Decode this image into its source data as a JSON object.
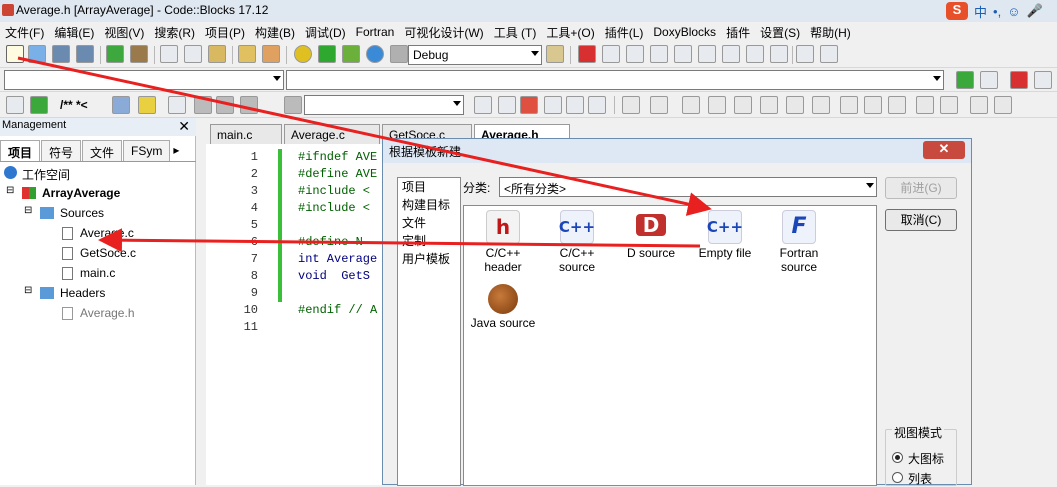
{
  "window": {
    "title": "Average.h [ArrayAverage] - Code::Blocks 17.12"
  },
  "ime": {
    "logo": "S",
    "lang": "中",
    "punct": "•,",
    "emoji": "☺",
    "mic": "🎤"
  },
  "menubar": [
    "文件(F)",
    "编辑(E)",
    "视图(V)",
    "搜索(R)",
    "项目(P)",
    "构建(B)",
    "调试(D)",
    "Fortran",
    "可视化设计(W)",
    "工具 (T)",
    "工具+(O)",
    "插件(L)",
    "DoxyBlocks",
    "插件",
    "设置(S)",
    "帮助(H)"
  ],
  "toolbar": {
    "build_target": "Debug",
    "comment_btn": "/** *<"
  },
  "management": {
    "title": "Management",
    "tabs": [
      "项目",
      "符号",
      "文件",
      "FSym"
    ],
    "workspace": "工作空间",
    "project": "ArrayAverage",
    "sources_folder": "Sources",
    "sources": [
      "Average.c",
      "GetSoce.c",
      "main.c"
    ],
    "headers_folder": "Headers",
    "headers": [
      "Average.h"
    ]
  },
  "editor": {
    "tabs": [
      "main.c",
      "Average.c",
      "GetSoce.c",
      "Average.h"
    ],
    "active_tab": "Average.h",
    "line_numbers": [
      "1",
      "2",
      "3",
      "4",
      "5",
      "6",
      "7",
      "8",
      "9",
      "10",
      "11"
    ],
    "lines": [
      "#ifndef AVE",
      "#define AVE",
      "#include <",
      "#include <",
      "",
      "#define N",
      "int Average",
      "void  GetS",
      "",
      "#endif // A",
      ""
    ]
  },
  "dialog": {
    "title": "根据模板新建",
    "categories": [
      "项目",
      "构建目标",
      "文件",
      "定制",
      "用户模板"
    ],
    "category_label": "分类:",
    "category_value": "<所有分类>",
    "next_button": "前进(G)",
    "cancel_button": "取消(C)",
    "templates": [
      {
        "label": "C/C++ header",
        "icon": "h",
        "color": "#c01818"
      },
      {
        "label": "C/C++ source",
        "icon": "C++",
        "color": "#1b46b8"
      },
      {
        "label": "D source",
        "icon": "D",
        "color": "#c0302c"
      },
      {
        "label": "Empty file",
        "icon": "C++",
        "color": "#1b46b8"
      },
      {
        "label": "Fortran source",
        "icon": "F",
        "color": "#1b46b8"
      },
      {
        "label": "Java source",
        "icon": "java-bean",
        "color": "#8a4a14"
      }
    ],
    "view_mode": {
      "label": "视图模式",
      "options": [
        "大图标",
        "列表"
      ],
      "selected": "大图标"
    }
  },
  "annotations": {
    "arrow_color": "#e8201f"
  }
}
